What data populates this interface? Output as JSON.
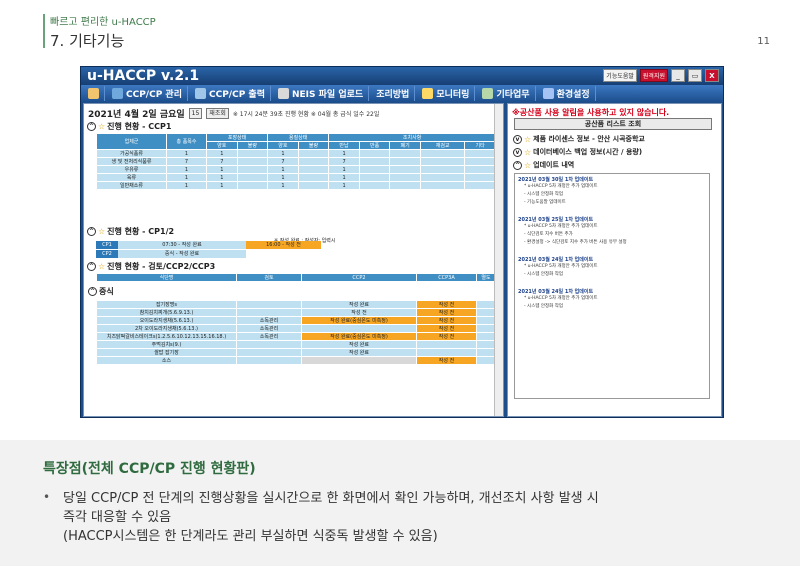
{
  "header": {
    "subtitle": "빠르고 편리한 u-HACCP",
    "title": "7. 기타기능",
    "page": "11"
  },
  "app": {
    "title": "u-HACCP v.2.1",
    "titlebar": {
      "homepage": "기능도움말",
      "support": "원격지원",
      "min": "_",
      "restore": "▭",
      "close": "X"
    },
    "menu": [
      {
        "label": "CCP/CP 관리",
        "icon": "check-icon",
        "color": "#6fa8dc"
      },
      {
        "label": "CCP/CP 출력",
        "icon": "printer-icon",
        "color": "#9fc5e8"
      },
      {
        "label": "NEIS 파일 업로드",
        "icon": "upload-icon",
        "color": "#d9d9d9"
      },
      {
        "label": "조리방법",
        "icon": "cook-icon",
        "color": "#f6b26b"
      },
      {
        "label": "모니터링",
        "icon": "monitor-icon",
        "color": "#ffd966"
      },
      {
        "label": "기타업무",
        "icon": "document-icon",
        "color": "#b6d7a8"
      },
      {
        "label": "환경설정",
        "icon": "gear-icon",
        "color": "#a4c2f4"
      }
    ],
    "main": {
      "date": "2021년 4월 2일 금요일",
      "calendar_day": "15",
      "refresh": "재조회",
      "datetime_note": "※ 17시 24분 39초 진행 현황 ※ 04월 총 급식 일수 22일",
      "sec1": {
        "title": "진행 현황 - CCP1",
        "headers": [
          "업체군",
          "총 품목수",
          "포장상태",
          "용질상태",
          "조치사항"
        ],
        "subheaders": [
          "양호",
          "불량",
          "양호",
          "불량",
          "반납",
          "반품",
          "폐기",
          "재검교",
          "기타"
        ],
        "rows": [
          [
            "가공식품류",
            "1",
            "1",
            "",
            "1",
            "",
            "1",
            "",
            "",
            "",
            ""
          ],
          [
            "생 및 전처리식품류",
            "7",
            "7",
            "",
            "7",
            "",
            "7",
            "",
            "",
            "",
            ""
          ],
          [
            "우유류",
            "1",
            "1",
            "",
            "1",
            "",
            "1",
            "",
            "",
            "",
            ""
          ],
          [
            "육류",
            "1",
            "1",
            "",
            "1",
            "",
            "1",
            "",
            "",
            "",
            ""
          ],
          [
            "일반채소류",
            "1",
            "1",
            "",
            "1",
            "",
            "1",
            "",
            "",
            "",
            ""
          ]
        ]
      },
      "sec2": {
        "title": "진행 현황 - CP1/2",
        "note": "※ 작성 완료 : 작성자: 입력시",
        "rows": [
          {
            "label": "CP1",
            "value": "07:30 - 작성 완료",
            "status": "16:00 - 작성 전"
          },
          {
            "label": "CP2",
            "value": "중식 - 작성 완료",
            "status": ""
          }
        ]
      },
      "sec3": {
        "title": "진행 현황 - 검토/CCP2/CCP3",
        "headers": [
          "식단명",
          "검토",
          "CCP2",
          "CCP3A",
          "멸도"
        ],
        "group": "중식",
        "rows": [
          {
            "name": "잡기장명s",
            "review": "",
            "ccp2": "작성 완료",
            "ccp3": "작성 전",
            "c2": "cell",
            "c3": "yel"
          },
          {
            "name": "참치김치찌개(5.6.9.13.)",
            "review": "",
            "ccp2": "작성 전",
            "ccp3": "작성 전",
            "c2": "cell",
            "c3": "yel"
          },
          {
            "name": "오이도라지생채(5.6.13.)",
            "review": "소독관리",
            "ccp2": "작성 완료(중심온도 미측정)",
            "ccp3": "작성 전",
            "c2": "yel",
            "c3": "yel"
          },
          {
            "name": "2차 오이도라지생채(5.6.13.)",
            "review": "소독관리",
            "ccp2": "",
            "ccp3": "작성 전",
            "c2": "cell",
            "c3": "yel"
          },
          {
            "name": "치즈닭떡갈비스테이크s(1.2.5.6.10.12.13.15.16.18.)",
            "review": "소독관리",
            "ccp2": "작성 완료(중심온도 미측정)",
            "ccp3": "작성 전",
            "c2": "yel",
            "c3": "yel"
          },
          {
            "name": "주먹김치s(9.)",
            "review": "",
            "ccp2": "작성 완료",
            "ccp3": "",
            "c2": "cell",
            "c3": "cell"
          },
          {
            "name": "쌀밥 잡기장",
            "review": "",
            "ccp2": "작성 완료",
            "ccp3": "",
            "c2": "cell",
            "c3": "cell"
          },
          {
            "name": "소스",
            "review": "",
            "ccp2": "",
            "ccp3": "작성 전",
            "c2": "gry",
            "c3": "yel"
          }
        ]
      }
    },
    "side": {
      "notice": "※공산품 사용 알림을 사용하고 있지 않습니다.",
      "list_button": "공산품 리스트 조회",
      "items": [
        "제품 라이센스 정보 - 안산 시곡중학교",
        "데이터베이스 백업 정보(시간 / 용량)",
        "업데이트 내역"
      ],
      "updates": [
        {
          "title": "2021년 03월 30일 1차 업데이트",
          "lines": [
            "* u-HACCP 5차 개정안 추가 업데이트",
            "- 시스템 안정화 작업",
            "- 기능도움말 업데이트"
          ]
        },
        {
          "title": "2021년 03월 25일 1차 업데이트",
          "lines": [
            "* u-HACCP 5차 개정안 추가 업데이트",
            "- 식단검토 지수 버튼 추가",
            "- 환경설정 -> 식단검토 지수 추가 버튼 사용 유무 설정"
          ]
        },
        {
          "title": "2021년 03월 24일 1차 업데이트",
          "lines": [
            "* u-HACCP 5차 개정안 추가 업데이트",
            "- 시스템 안정화 작업"
          ]
        },
        {
          "title": "2021년 03월 24일 1차 업데이트",
          "lines": [
            "* u-HACCP 5차 개정안 추가 업데이트",
            "- 시스템 안정화 작업"
          ]
        }
      ]
    }
  },
  "bottom": {
    "heading": "특장점(전체 CCP/CP 진행 현황판)",
    "bullet": "•",
    "line1": "당일 CCP/CP 전 단계의 진행상황을 실시간으로 한 화면에서 확인 가능하며, 개선조치 사항 발생 시",
    "line2": "즉각 대응할 수 있음",
    "line3": "(HACCP시스템은 한 단계라도 관리 부실하면 식중독 발생할 수 있음)"
  }
}
